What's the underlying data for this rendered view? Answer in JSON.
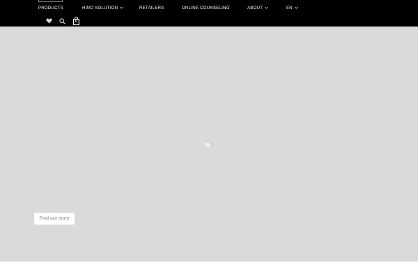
{
  "header": {
    "nav": [
      {
        "label": "PRODUCTS",
        "has_dropdown": false
      },
      {
        "label": "HINO SOLUTION",
        "has_dropdown": true
      },
      {
        "label": "RETAILERS",
        "has_dropdown": false
      },
      {
        "label": "ONLINE COUNSELING",
        "has_dropdown": false
      },
      {
        "label": "ABOUT",
        "has_dropdown": true
      },
      {
        "label": "EN",
        "has_dropdown": true
      }
    ],
    "icons": [
      "heart-icon",
      "search-icon",
      "shopping-bag-icon"
    ],
    "cart_count": "0"
  },
  "hero": {
    "cta_label": "Find out more"
  },
  "colors": {
    "header_bg": "#000000",
    "hero_bg": "#dadada",
    "cta_text": "#8a8a8a"
  }
}
